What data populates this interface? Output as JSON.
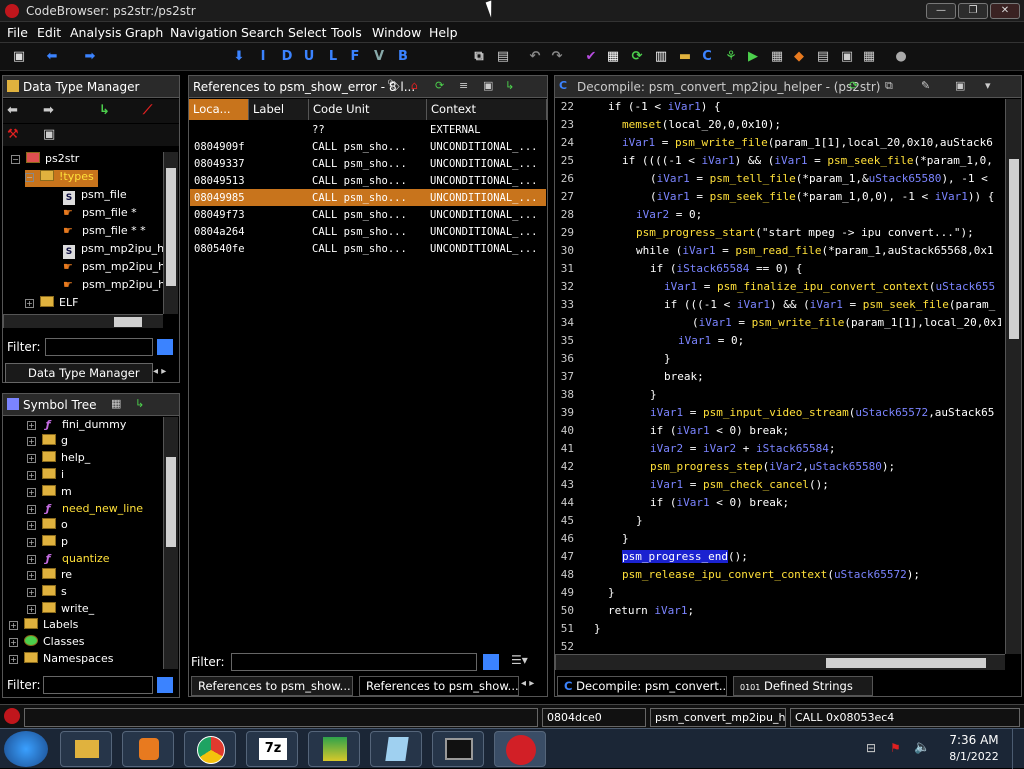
{
  "window": {
    "title": "CodeBrowser: ps2str:/ps2str"
  },
  "menu": [
    "File",
    "Edit",
    "Analysis",
    "Graph",
    "Navigation",
    "Search",
    "Select",
    "Tools",
    "Window",
    "Help"
  ],
  "toolbar": {
    "letters": [
      "I",
      "D",
      "U",
      "L",
      "F",
      "V",
      "B"
    ]
  },
  "dtm": {
    "title": "Data Type Manager",
    "tree": [
      {
        "label": "ps2str",
        "type": "root"
      },
      {
        "label": "!types",
        "type": "folder",
        "selected": true
      },
      {
        "label": "psm_file",
        "type": "struct"
      },
      {
        "label": "psm_file *",
        "type": "ptr"
      },
      {
        "label": "psm_file * *",
        "type": "ptr"
      },
      {
        "label": "psm_mp2ipu_h",
        "type": "struct"
      },
      {
        "label": "psm_mp2ipu_h",
        "type": "ptr"
      },
      {
        "label": "psm_mp2ipu_h",
        "type": "ptr"
      },
      {
        "label": "ELF",
        "type": "folder"
      }
    ],
    "filter_label": "Filter:",
    "tab_label": "Data Type Manager"
  },
  "symtree": {
    "title": "Symbol Tree",
    "items": [
      {
        "label": "fini_dummy",
        "type": "func"
      },
      {
        "label": "g",
        "type": "folder"
      },
      {
        "label": "help_",
        "type": "folder"
      },
      {
        "label": "i",
        "type": "folder"
      },
      {
        "label": "m",
        "type": "folder"
      },
      {
        "label": "need_new_line",
        "type": "func"
      },
      {
        "label": "o",
        "type": "folder"
      },
      {
        "label": "p",
        "type": "folder"
      },
      {
        "label": "quantize",
        "type": "func"
      },
      {
        "label": "re",
        "type": "folder"
      },
      {
        "label": "s",
        "type": "folder"
      },
      {
        "label": "write_",
        "type": "folder"
      },
      {
        "label": "Labels",
        "type": "folder",
        "top": true
      },
      {
        "label": "Classes",
        "type": "classes",
        "top": true
      },
      {
        "label": "Namespaces",
        "type": "folder",
        "top": true
      }
    ],
    "filter_label": "Filter:"
  },
  "refs": {
    "title": "References to psm_show_error - 8 l...",
    "columns": [
      "Loca...",
      "Label",
      "Code Unit",
      "Context"
    ],
    "rows": [
      {
        "loc": "",
        "label": "",
        "code": "??",
        "ctx": "EXTERNAL"
      },
      {
        "loc": "0804909f",
        "label": "",
        "code": "CALL psm_sho...",
        "ctx": "UNCONDITIONAL_..."
      },
      {
        "loc": "08049337",
        "label": "",
        "code": "CALL psm_sho...",
        "ctx": "UNCONDITIONAL_..."
      },
      {
        "loc": "08049513",
        "label": "",
        "code": "CALL psm_sho...",
        "ctx": "UNCONDITIONAL_..."
      },
      {
        "loc": "08049985",
        "label": "",
        "code": "CALL psm_sho...",
        "ctx": "UNCONDITIONAL_...",
        "selected": true
      },
      {
        "loc": "08049f73",
        "label": "",
        "code": "CALL psm_sho...",
        "ctx": "UNCONDITIONAL_..."
      },
      {
        "loc": "0804a264",
        "label": "",
        "code": "CALL psm_sho...",
        "ctx": "UNCONDITIONAL_..."
      },
      {
        "loc": "080540fe",
        "label": "",
        "code": "CALL psm_sho...",
        "ctx": "UNCONDITIONAL_..."
      }
    ],
    "filter_label": "Filter:",
    "tabs": [
      "References to psm_show...",
      "References to psm_show..."
    ]
  },
  "decomp": {
    "title": "Decompile: psm_convert_mp2ipu_helper - (ps2str)",
    "lines": [
      {
        "n": "22",
        "i": 1,
        "t": "if (-1 < iVar1) {"
      },
      {
        "n": "23",
        "i": 2,
        "t": "memset(local_20,0,0x10);"
      },
      {
        "n": "24",
        "i": 2,
        "t": "iVar1 = psm_write_file(param_1[1],local_20,0x10,auStack6"
      },
      {
        "n": "25",
        "i": 2,
        "t": "if ((((-1 < iVar1) && (iVar1 = psm_seek_file(*param_1,0,"
      },
      {
        "n": "26",
        "i": 4,
        "t": "(iVar1 = psm_tell_file(*param_1,&uStack65580), -1 <"
      },
      {
        "n": "27",
        "i": 4,
        "t": "(iVar1 = psm_seek_file(*param_1,0,0), -1 < iVar1)) {"
      },
      {
        "n": "28",
        "i": 3,
        "t": "iVar2 = 0;"
      },
      {
        "n": "29",
        "i": 3,
        "t": "psm_progress_start(\"start mpeg -> ipu convert...\");"
      },
      {
        "n": "30",
        "i": 3,
        "t": "while (iVar1 = psm_read_file(*param_1,auStack65568,0x1"
      },
      {
        "n": "31",
        "i": 4,
        "t": "if (iStack65584 == 0) {"
      },
      {
        "n": "32",
        "i": 5,
        "t": "iVar1 = psm_finalize_ipu_convert_context(uStack655"
      },
      {
        "n": "33",
        "i": 5,
        "t": "if (((-1 < iVar1) && (iVar1 = psm_seek_file(param_"
      },
      {
        "n": "34",
        "i": 7,
        "t": "(iVar1 = psm_write_file(param_1[1],local_20,0x1"
      },
      {
        "n": "35",
        "i": 6,
        "t": "iVar1 = 0;"
      },
      {
        "n": "36",
        "i": 5,
        "t": "}"
      },
      {
        "n": "37",
        "i": 5,
        "t": "break;"
      },
      {
        "n": "38",
        "i": 4,
        "t": "}"
      },
      {
        "n": "39",
        "i": 4,
        "t": "iVar1 = psm_input_video_stream(uStack65572,auStack65"
      },
      {
        "n": "40",
        "i": 4,
        "t": "if (iVar1 < 0) break;"
      },
      {
        "n": "41",
        "i": 4,
        "t": "iVar2 = iVar2 + iStack65584;"
      },
      {
        "n": "42",
        "i": 4,
        "t": "psm_progress_step(iVar2,uStack65580);"
      },
      {
        "n": "43",
        "i": 4,
        "t": "iVar1 = psm_check_cancel();"
      },
      {
        "n": "44",
        "i": 4,
        "t": "if (iVar1 < 0) break;"
      },
      {
        "n": "45",
        "i": 3,
        "t": "}"
      },
      {
        "n": "46",
        "i": 2,
        "t": "}"
      },
      {
        "n": "47",
        "i": 2,
        "t": "psm_progress_end();",
        "hl": true
      },
      {
        "n": "48",
        "i": 2,
        "t": "psm_release_ipu_convert_context(uStack65572);"
      },
      {
        "n": "49",
        "i": 1,
        "t": "}"
      },
      {
        "n": "50",
        "i": 1,
        "t": "return iVar1;"
      },
      {
        "n": "51",
        "i": 0,
        "t": "}"
      },
      {
        "n": "52",
        "i": 0,
        "t": ""
      }
    ],
    "tabs": [
      "Decompile: psm_convert...",
      "Defined Strings"
    ]
  },
  "status": {
    "addr": "0804dce0",
    "func": "psm_convert_mp2ipu_h...",
    "instr": "CALL 0x08053ec4"
  },
  "clock": {
    "time": "7:36 AM",
    "date": "8/1/2022"
  },
  "colors": {
    "selected_row": "#c8741c",
    "keyword": "#ffffff",
    "function": "#ffe03a",
    "variable": "#7b84ff",
    "highlight": "#1a22d0"
  }
}
